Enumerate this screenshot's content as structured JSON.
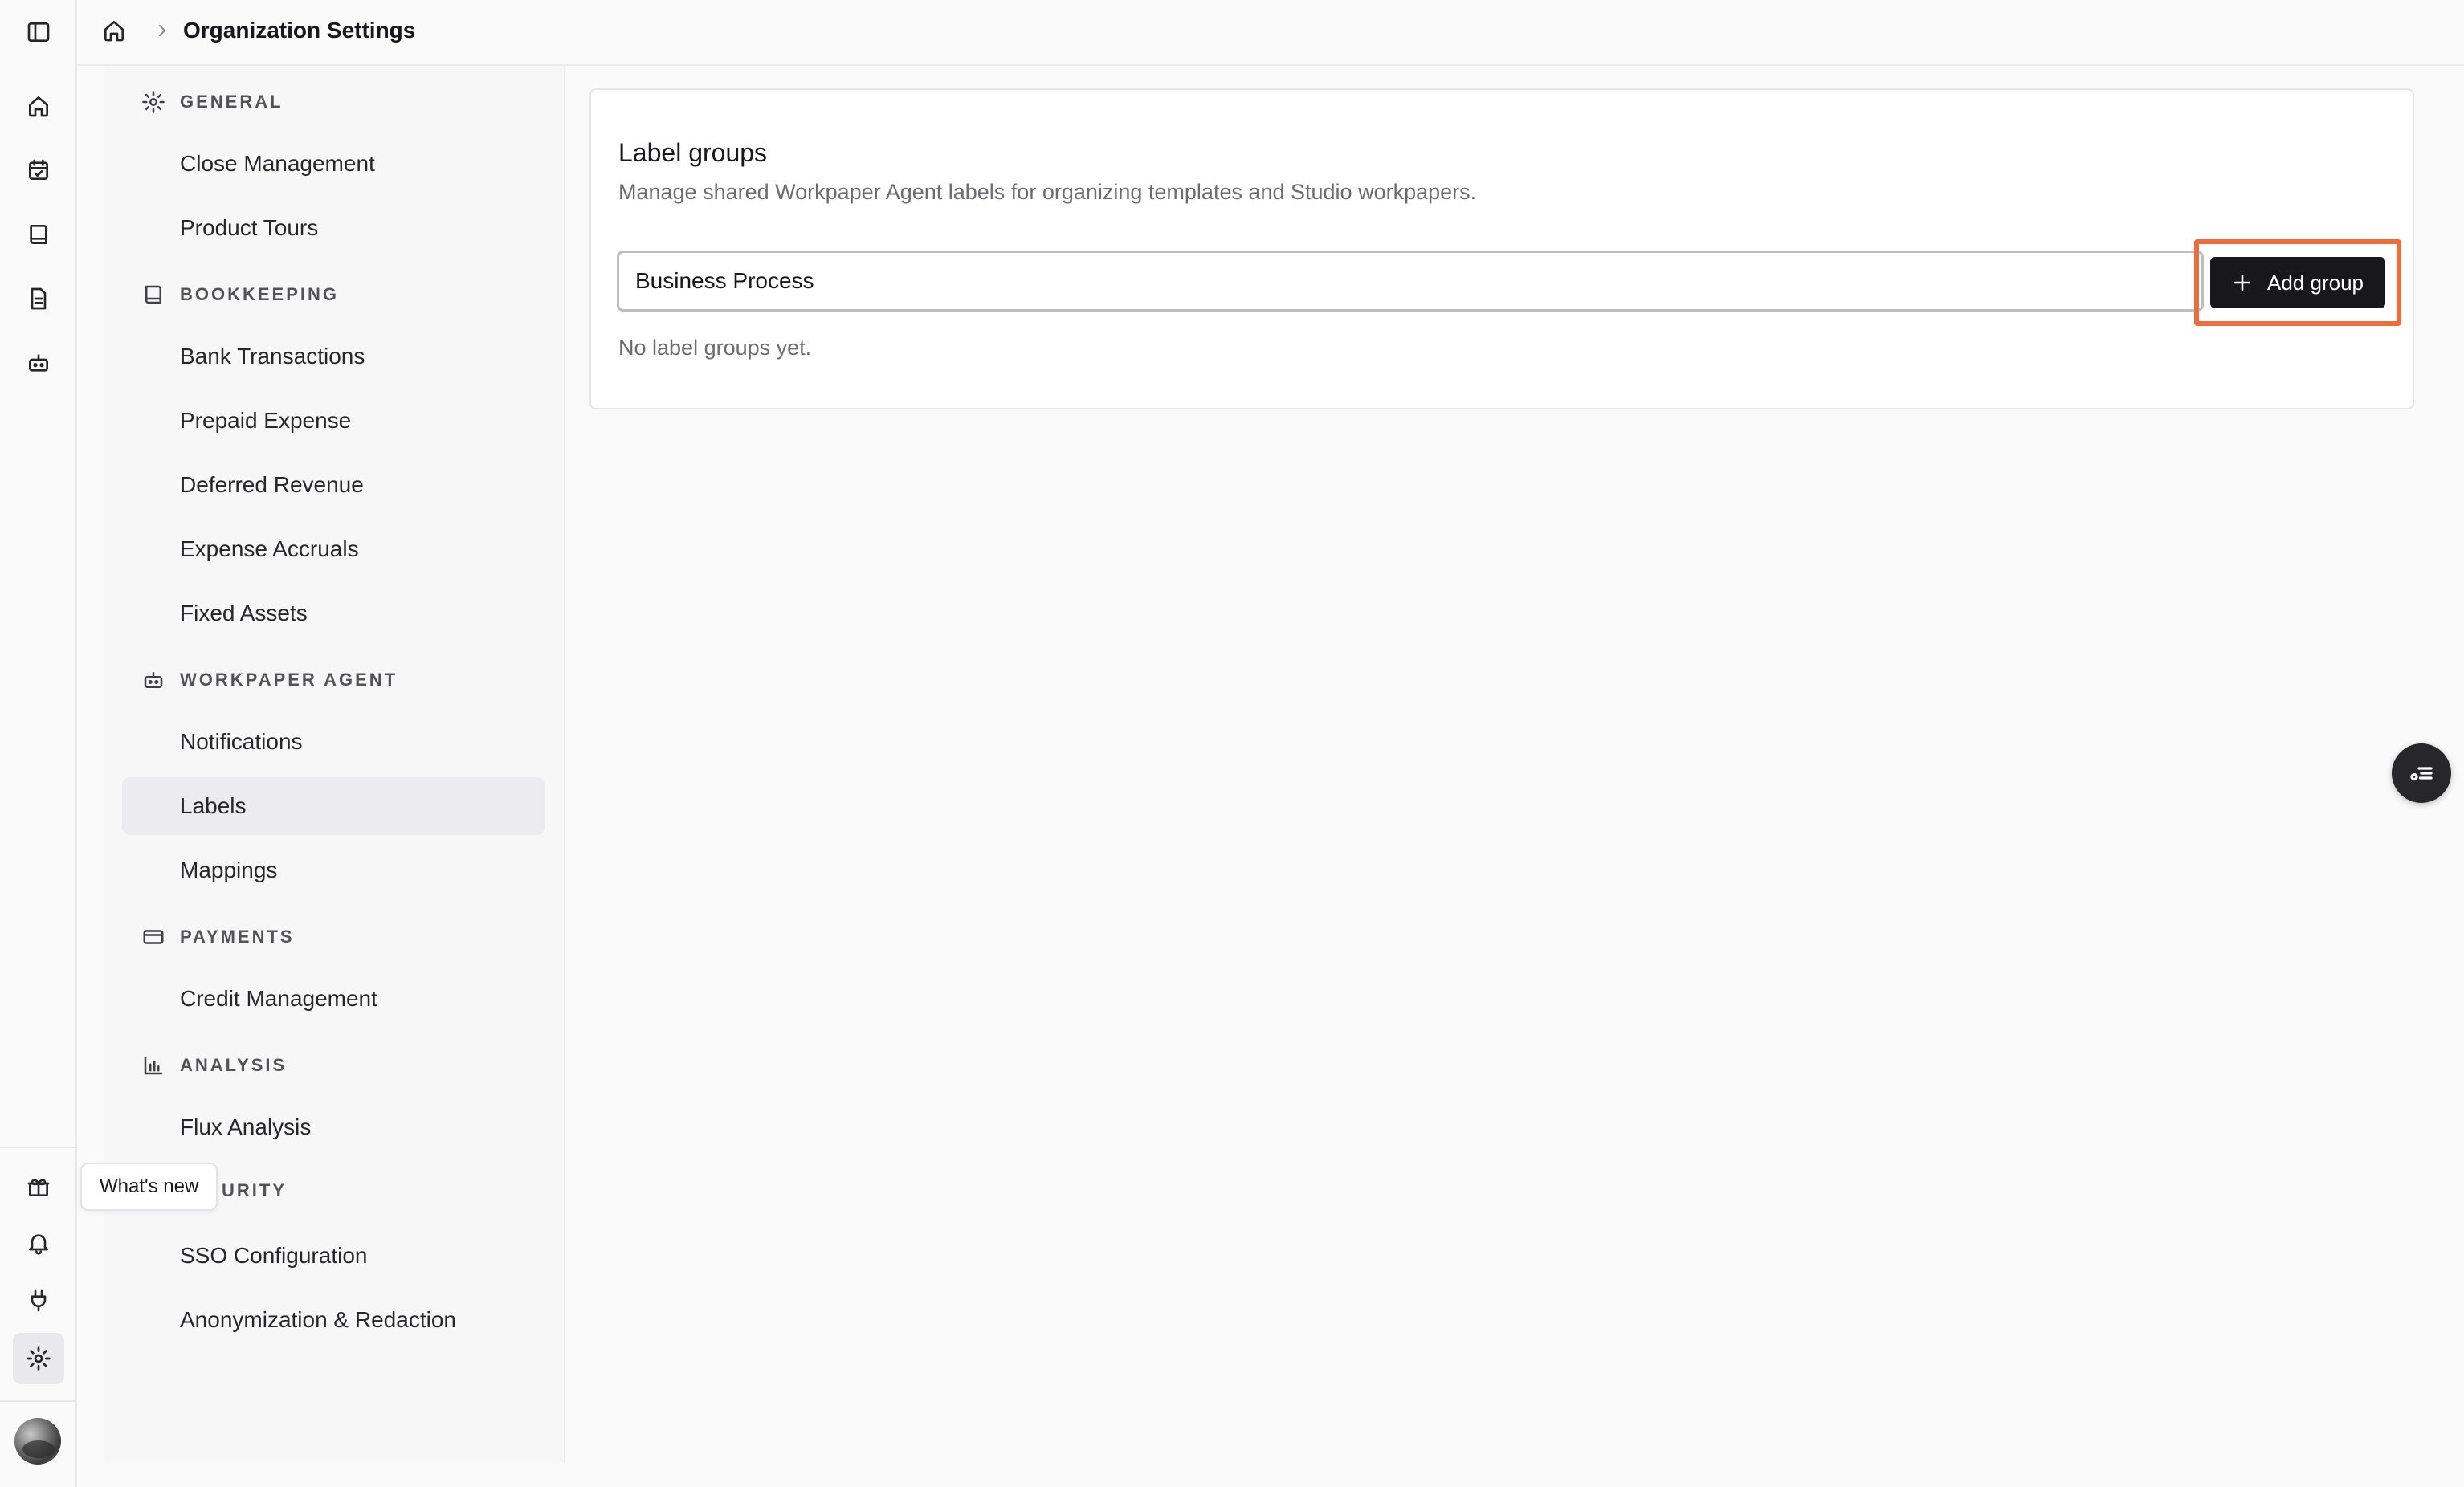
{
  "header": {
    "title": "Organization Settings"
  },
  "rail": {
    "icons": [
      "sidebar-toggle-icon",
      "home-icon",
      "calendar-check-icon",
      "book-icon",
      "document-icon",
      "bot-icon",
      "gift-icon",
      "bell-icon",
      "plug-icon",
      "gear-icon",
      "avatar"
    ]
  },
  "tooltip": {
    "text": "What's new"
  },
  "nav": {
    "general": {
      "label": "GENERAL",
      "items": [
        "Close Management",
        "Product Tours"
      ]
    },
    "bookkeeping": {
      "label": "BOOKKEEPING",
      "items": [
        "Bank Transactions",
        "Prepaid Expense",
        "Deferred Revenue",
        "Expense Accruals",
        "Fixed Assets"
      ]
    },
    "workpaper_agent": {
      "label": "WORKPAPER AGENT",
      "items": [
        "Notifications",
        "Labels",
        "Mappings"
      ]
    },
    "payments": {
      "label": "PAYMENTS",
      "items": [
        "Credit Management"
      ]
    },
    "analysis": {
      "label": "ANALYSIS",
      "items": [
        "Flux Analysis"
      ]
    },
    "security": {
      "label": "URITY",
      "items": [
        "SSO Configuration",
        "Anonymization & Redaction"
      ]
    },
    "active_item": "Labels"
  },
  "main": {
    "title": "Label groups",
    "description": "Manage shared Workpaper Agent labels for organizing templates and Studio workpapers.",
    "input_value": "Business Process",
    "add_button_label": "Add group",
    "empty_text": "No label groups yet."
  },
  "colors": {
    "highlight": "#ef6c3c",
    "button_bg": "#18181b",
    "active_bg": "#ececee"
  }
}
